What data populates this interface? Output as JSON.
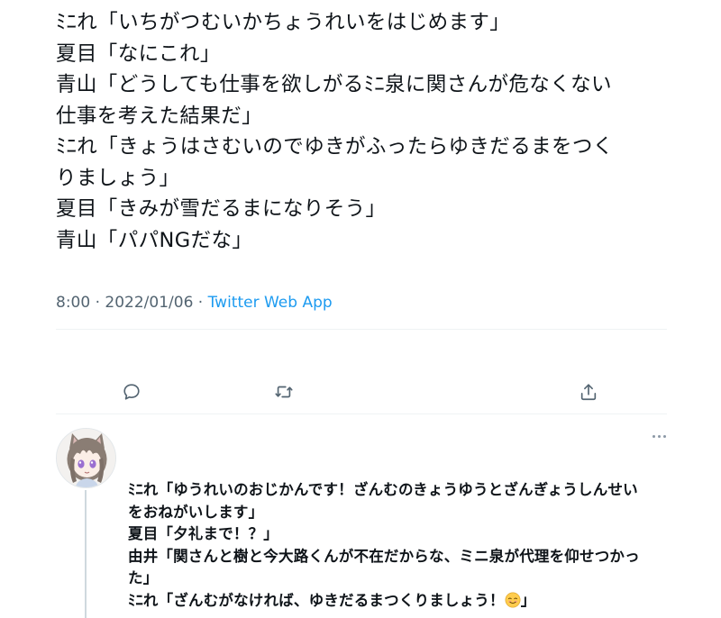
{
  "tweet": {
    "lines": [
      "ﾐﾆれ「いちがつむいかちょうれいをはじめます」",
      "夏目「なにこれ」",
      "青山「どうしても仕事を欲しがるﾐﾆ泉に関さんが危なくない",
      "仕事を考えた結果だ」",
      "ﾐﾆれ「きょうはさむいのでゆきがふったらゆきだるまをつく",
      "りましょう」",
      "夏目「きみが雪だるまになりそう」",
      "青山「パパNGだな」"
    ],
    "time": "8:00",
    "separator": " · ",
    "date": "2022/01/06",
    "source": "Twitter Web App"
  },
  "actions": {
    "reply": "reply-icon",
    "retweet": "retweet-icon",
    "share": "share-icon"
  },
  "reply": {
    "lines": [
      "ﾐﾆれ「ゆうれいのおじかんです！ざんむのきょうゆうとざんぎょうしんせい",
      "をおねがいします」",
      "夏目「夕礼まで！？」",
      "由井「関さんと樹と今大路くんが不在だからな、ミニ泉が代理を仰せつかっ",
      "た」"
    ],
    "last_line_text": "ﾐﾆれ「ざんむがなければ、ゆきだるまつくりましょう！",
    "last_line_emoji": "smiling-face-emoji",
    "last_line_close": "」"
  },
  "colors": {
    "text": "#0f1419",
    "muted": "#536471",
    "link": "#1d9bf0",
    "divider": "#eff3f4",
    "thread_line": "#cfd9de"
  }
}
